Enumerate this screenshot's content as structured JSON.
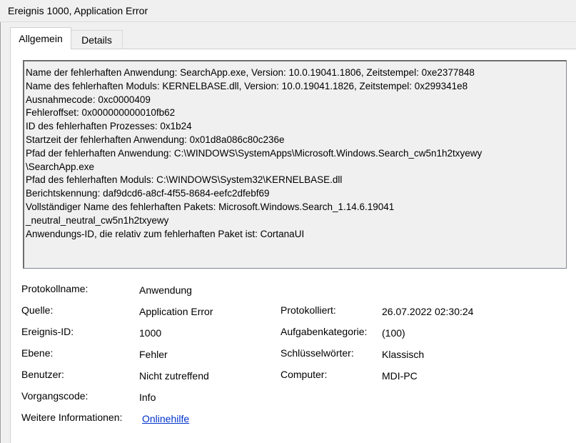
{
  "window": {
    "title": "Ereignis 1000, Application Error"
  },
  "tabs": [
    {
      "label": "Allgemein",
      "active": true
    },
    {
      "label": "Details",
      "active": false
    }
  ],
  "description": {
    "lines": [
      "Name der fehlerhaften Anwendung: SearchApp.exe, Version: 10.0.19041.1806, Zeitstempel: 0xe2377848",
      "Name des fehlerhaften Moduls: KERNELBASE.dll, Version: 10.0.19041.1826, Zeitstempel: 0x299341e8",
      "Ausnahmecode: 0xc0000409",
      "Fehleroffset: 0x000000000010fb62",
      "ID des fehlerhaften Prozesses: 0x1b24",
      "Startzeit der fehlerhaften Anwendung: 0x01d8a086c80c236e",
      "Pfad der fehlerhaften Anwendung: C:\\WINDOWS\\SystemApps\\Microsoft.Windows.Search_cw5n1h2txyewy",
      "\\SearchApp.exe",
      "Pfad des fehlerhaften Moduls: C:\\WINDOWS\\System32\\KERNELBASE.dll",
      "Berichtskennung: daf9dcd6-a8cf-4f55-8684-eefc2dfebf69",
      "Vollständiger Name des fehlerhaften Pakets: Microsoft.Windows.Search_1.14.6.19041",
      "_neutral_neutral_cw5n1h2txyewy",
      "Anwendungs-ID, die relativ zum fehlerhaften Paket ist: CortanaUI"
    ]
  },
  "properties": {
    "protokollname": {
      "label": "Protokollname:",
      "value": "Anwendung"
    },
    "quelle": {
      "label": "Quelle:",
      "value": "Application Error"
    },
    "protokolliert": {
      "label": "Protokolliert:",
      "value": "26.07.2022 02:30:24"
    },
    "ereignis_id": {
      "label": "Ereignis-ID:",
      "value": "1000"
    },
    "aufgabenkategorie": {
      "label": "Aufgabenkategorie:",
      "value": "(100)"
    },
    "ebene": {
      "label": "Ebene:",
      "value": "Fehler"
    },
    "schluesselwoerter": {
      "label": "Schlüsselwörter:",
      "value": "Klassisch"
    },
    "benutzer": {
      "label": "Benutzer:",
      "value": "Nicht zutreffend"
    },
    "computer": {
      "label": "Computer:",
      "value": "MDI-PC"
    },
    "vorgangscode": {
      "label": "Vorgangscode:",
      "value": "Info"
    },
    "weitere_informationen": {
      "label": "Weitere Informationen:",
      "link": "Onlinehilfe"
    }
  }
}
